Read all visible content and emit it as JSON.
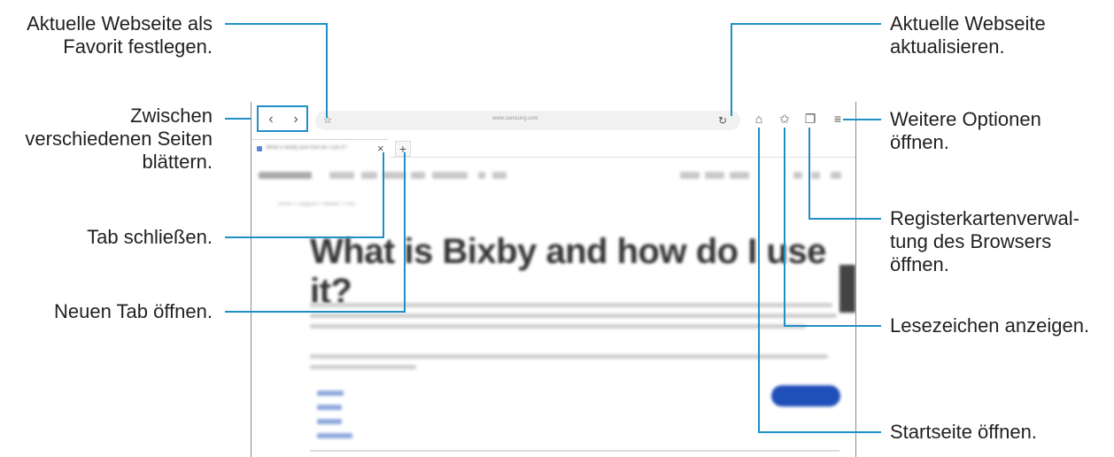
{
  "annotations": {
    "favorite": [
      "Aktuelle Webseite als",
      "Favorit festlegen."
    ],
    "navigate": [
      "Zwischen",
      "verschiedenen Seiten",
      "blättern."
    ],
    "close_tab": [
      "Tab schließen."
    ],
    "new_tab": [
      "Neuen Tab öffnen."
    ],
    "refresh": [
      "Aktuelle Webseite",
      "aktualisieren."
    ],
    "more_options": [
      "Weitere Optionen",
      "öffnen."
    ],
    "tab_manager": [
      "Registerkartenverwal-",
      "tung des Browsers",
      "öffnen."
    ],
    "bookmarks": [
      "Lesezeichen anzeigen."
    ],
    "home": [
      "Startseite öffnen."
    ]
  },
  "browser": {
    "url": "www.samsung.com",
    "tab_title": "What is Bixby and how do I use it?",
    "headline": "What is Bixby and how do I use it?",
    "breadcrumb": "Home > Support > Mobile > FAQ",
    "icons": {
      "back": "chevron-left-icon",
      "forward": "chevron-right-icon",
      "favorite": "star-icon",
      "refresh": "refresh-icon",
      "home": "home-icon",
      "bookmarks": "bookmark-star-icon",
      "tabs": "tabs-icon",
      "menu": "menu-icon",
      "close_tab": "close-icon",
      "new_tab": "plus-icon"
    }
  },
  "colors": {
    "callout_line": "#1f8fc6",
    "text": "#231f20",
    "cta": "#1f4fb8"
  }
}
